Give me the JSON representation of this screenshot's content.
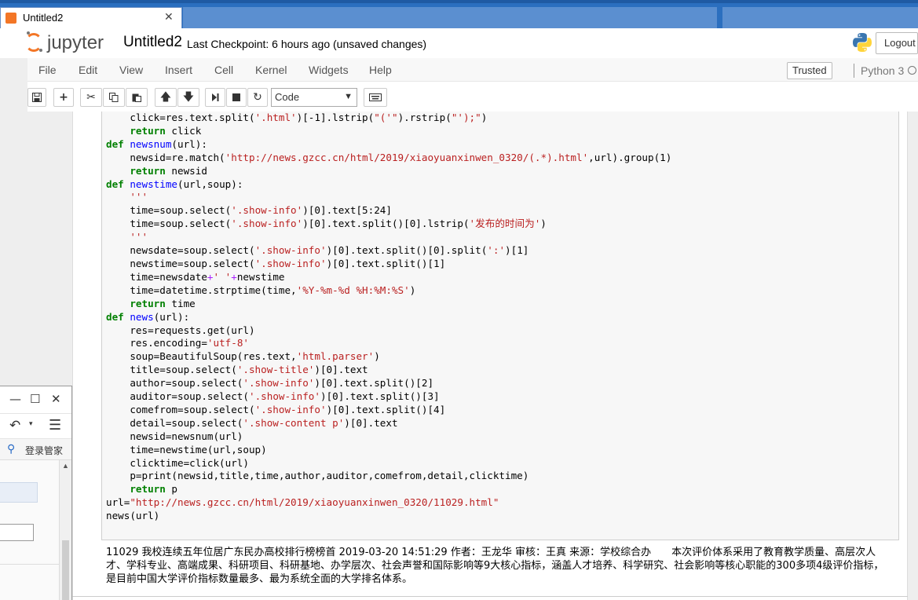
{
  "browser": {
    "tab_title": "Untitled2",
    "tab_close": "✕"
  },
  "header": {
    "logo_text": "jupyter",
    "notebook_name": "Untitled2",
    "checkpoint": "Last Checkpoint: 6 hours ago (unsaved changes)",
    "logout_label": "Logout"
  },
  "menubar": {
    "items": [
      "File",
      "Edit",
      "View",
      "Insert",
      "Cell",
      "Kernel",
      "Widgets",
      "Help"
    ],
    "trusted_label": "Trusted",
    "kernel_name": "Python 3"
  },
  "toolbar": {
    "cell_type": "Code"
  },
  "code_lines": [
    "    click=res.text.split('.html')[-1].lstrip(\"('\").rstrip(\"');\")",
    "    return click",
    "def newsnum(url):",
    "    newsid=re.match('http://news.gzcc.cn/html/2019/xiaoyuanxinwen_0320/(.*).html',url).group(1)",
    "    return newsid",
    "def newstime(url,soup):",
    "    '''",
    "    time=soup.select('.show-info')[0].text[5:24]",
    "    time=soup.select('.show-info')[0].text.split()[0].lstrip('发布的时间为')",
    "    '''",
    "    newsdate=soup.select('.show-info')[0].text.split()[0].split(':')[1]",
    "    newstime=soup.select('.show-info')[0].text.split()[1]",
    "    time=newsdate+' '+newstime",
    "    time=datetime.strptime(time,'%Y-%m-%d %H:%M:%S')",
    "    return time",
    "def news(url):",
    "    res=requests.get(url)",
    "    res.encoding='utf-8'",
    "    soup=BeautifulSoup(res.text,'html.parser')",
    "    title=soup.select('.show-title')[0].text",
    "    author=soup.select('.show-info')[0].text.split()[2]",
    "    auditor=soup.select('.show-info')[0].text.split()[3]",
    "    comefrom=soup.select('.show-info')[0].text.split()[4]",
    "    detail=soup.select('.show-content p')[0].text",
    "    newsid=newsnum(url)",
    "    time=newstime(url,soup)",
    "    clicktime=click(url)",
    "    p=print(newsid,title,time,author,auditor,comefrom,detail,clicktime)",
    "    return p",
    "url=\"http://news.gzcc.cn/html/2019/xiaoyuanxinwen_0320/11029.html\"",
    "news(url)"
  ],
  "output_text": "11029 我校连续五年位居广东民办高校排行榜榜首 2019-03-20 14:51:29 作者：王龙华 审核：王真 来源：学校综合办　　本次评价体系采用了教育教学质量、高层次人才、学科专业、高端成果、科研项目、科研基地、办学层次、社会声誉和国际影响等9大核心指标，涵盖人才培养、科学研究、社会影响等核心职能的300多项4级评价指标，是目前中国大学评价指标数量最多、最为系统全面的大学排名体系。",
  "popup": {
    "login_label": "登录管家"
  },
  "colors": {
    "jupyter_orange": "#f37626",
    "keyword": "#008000",
    "function_name": "#0000ff",
    "string": "#ba2121",
    "operator": "#aa22ff",
    "tab_strip": "#2b6fbf"
  }
}
